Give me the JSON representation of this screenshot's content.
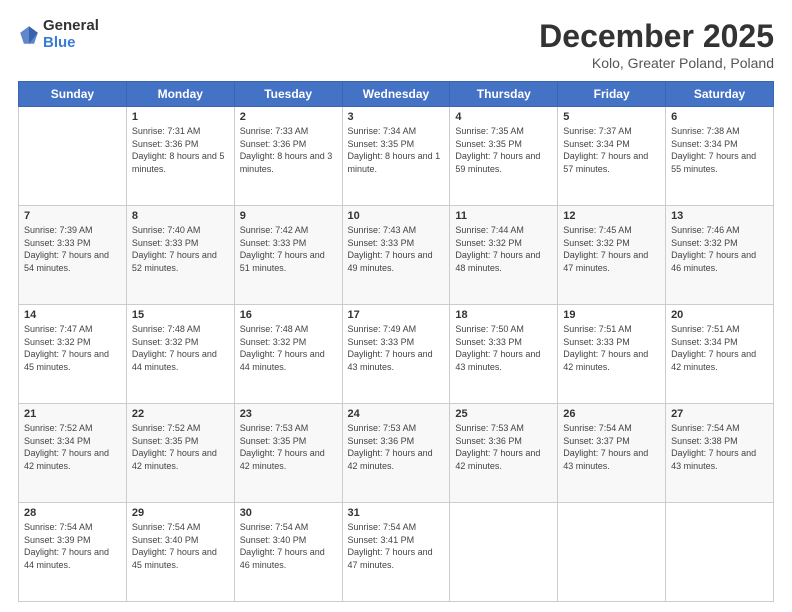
{
  "logo": {
    "general": "General",
    "blue": "Blue"
  },
  "title": "December 2025",
  "location": "Kolo, Greater Poland, Poland",
  "weekdays": [
    "Sunday",
    "Monday",
    "Tuesday",
    "Wednesday",
    "Thursday",
    "Friday",
    "Saturday"
  ],
  "weeks": [
    [
      {
        "day": "",
        "sunrise": "",
        "sunset": "",
        "daylight": ""
      },
      {
        "day": "1",
        "sunrise": "Sunrise: 7:31 AM",
        "sunset": "Sunset: 3:36 PM",
        "daylight": "Daylight: 8 hours and 5 minutes."
      },
      {
        "day": "2",
        "sunrise": "Sunrise: 7:33 AM",
        "sunset": "Sunset: 3:36 PM",
        "daylight": "Daylight: 8 hours and 3 minutes."
      },
      {
        "day": "3",
        "sunrise": "Sunrise: 7:34 AM",
        "sunset": "Sunset: 3:35 PM",
        "daylight": "Daylight: 8 hours and 1 minute."
      },
      {
        "day": "4",
        "sunrise": "Sunrise: 7:35 AM",
        "sunset": "Sunset: 3:35 PM",
        "daylight": "Daylight: 7 hours and 59 minutes."
      },
      {
        "day": "5",
        "sunrise": "Sunrise: 7:37 AM",
        "sunset": "Sunset: 3:34 PM",
        "daylight": "Daylight: 7 hours and 57 minutes."
      },
      {
        "day": "6",
        "sunrise": "Sunrise: 7:38 AM",
        "sunset": "Sunset: 3:34 PM",
        "daylight": "Daylight: 7 hours and 55 minutes."
      }
    ],
    [
      {
        "day": "7",
        "sunrise": "Sunrise: 7:39 AM",
        "sunset": "Sunset: 3:33 PM",
        "daylight": "Daylight: 7 hours and 54 minutes."
      },
      {
        "day": "8",
        "sunrise": "Sunrise: 7:40 AM",
        "sunset": "Sunset: 3:33 PM",
        "daylight": "Daylight: 7 hours and 52 minutes."
      },
      {
        "day": "9",
        "sunrise": "Sunrise: 7:42 AM",
        "sunset": "Sunset: 3:33 PM",
        "daylight": "Daylight: 7 hours and 51 minutes."
      },
      {
        "day": "10",
        "sunrise": "Sunrise: 7:43 AM",
        "sunset": "Sunset: 3:33 PM",
        "daylight": "Daylight: 7 hours and 49 minutes."
      },
      {
        "day": "11",
        "sunrise": "Sunrise: 7:44 AM",
        "sunset": "Sunset: 3:32 PM",
        "daylight": "Daylight: 7 hours and 48 minutes."
      },
      {
        "day": "12",
        "sunrise": "Sunrise: 7:45 AM",
        "sunset": "Sunset: 3:32 PM",
        "daylight": "Daylight: 7 hours and 47 minutes."
      },
      {
        "day": "13",
        "sunrise": "Sunrise: 7:46 AM",
        "sunset": "Sunset: 3:32 PM",
        "daylight": "Daylight: 7 hours and 46 minutes."
      }
    ],
    [
      {
        "day": "14",
        "sunrise": "Sunrise: 7:47 AM",
        "sunset": "Sunset: 3:32 PM",
        "daylight": "Daylight: 7 hours and 45 minutes."
      },
      {
        "day": "15",
        "sunrise": "Sunrise: 7:48 AM",
        "sunset": "Sunset: 3:32 PM",
        "daylight": "Daylight: 7 hours and 44 minutes."
      },
      {
        "day": "16",
        "sunrise": "Sunrise: 7:48 AM",
        "sunset": "Sunset: 3:32 PM",
        "daylight": "Daylight: 7 hours and 44 minutes."
      },
      {
        "day": "17",
        "sunrise": "Sunrise: 7:49 AM",
        "sunset": "Sunset: 3:33 PM",
        "daylight": "Daylight: 7 hours and 43 minutes."
      },
      {
        "day": "18",
        "sunrise": "Sunrise: 7:50 AM",
        "sunset": "Sunset: 3:33 PM",
        "daylight": "Daylight: 7 hours and 43 minutes."
      },
      {
        "day": "19",
        "sunrise": "Sunrise: 7:51 AM",
        "sunset": "Sunset: 3:33 PM",
        "daylight": "Daylight: 7 hours and 42 minutes."
      },
      {
        "day": "20",
        "sunrise": "Sunrise: 7:51 AM",
        "sunset": "Sunset: 3:34 PM",
        "daylight": "Daylight: 7 hours and 42 minutes."
      }
    ],
    [
      {
        "day": "21",
        "sunrise": "Sunrise: 7:52 AM",
        "sunset": "Sunset: 3:34 PM",
        "daylight": "Daylight: 7 hours and 42 minutes."
      },
      {
        "day": "22",
        "sunrise": "Sunrise: 7:52 AM",
        "sunset": "Sunset: 3:35 PM",
        "daylight": "Daylight: 7 hours and 42 minutes."
      },
      {
        "day": "23",
        "sunrise": "Sunrise: 7:53 AM",
        "sunset": "Sunset: 3:35 PM",
        "daylight": "Daylight: 7 hours and 42 minutes."
      },
      {
        "day": "24",
        "sunrise": "Sunrise: 7:53 AM",
        "sunset": "Sunset: 3:36 PM",
        "daylight": "Daylight: 7 hours and 42 minutes."
      },
      {
        "day": "25",
        "sunrise": "Sunrise: 7:53 AM",
        "sunset": "Sunset: 3:36 PM",
        "daylight": "Daylight: 7 hours and 42 minutes."
      },
      {
        "day": "26",
        "sunrise": "Sunrise: 7:54 AM",
        "sunset": "Sunset: 3:37 PM",
        "daylight": "Daylight: 7 hours and 43 minutes."
      },
      {
        "day": "27",
        "sunrise": "Sunrise: 7:54 AM",
        "sunset": "Sunset: 3:38 PM",
        "daylight": "Daylight: 7 hours and 43 minutes."
      }
    ],
    [
      {
        "day": "28",
        "sunrise": "Sunrise: 7:54 AM",
        "sunset": "Sunset: 3:39 PM",
        "daylight": "Daylight: 7 hours and 44 minutes."
      },
      {
        "day": "29",
        "sunrise": "Sunrise: 7:54 AM",
        "sunset": "Sunset: 3:40 PM",
        "daylight": "Daylight: 7 hours and 45 minutes."
      },
      {
        "day": "30",
        "sunrise": "Sunrise: 7:54 AM",
        "sunset": "Sunset: 3:40 PM",
        "daylight": "Daylight: 7 hours and 46 minutes."
      },
      {
        "day": "31",
        "sunrise": "Sunrise: 7:54 AM",
        "sunset": "Sunset: 3:41 PM",
        "daylight": "Daylight: 7 hours and 47 minutes."
      },
      {
        "day": "",
        "sunrise": "",
        "sunset": "",
        "daylight": ""
      },
      {
        "day": "",
        "sunrise": "",
        "sunset": "",
        "daylight": ""
      },
      {
        "day": "",
        "sunrise": "",
        "sunset": "",
        "daylight": ""
      }
    ]
  ]
}
